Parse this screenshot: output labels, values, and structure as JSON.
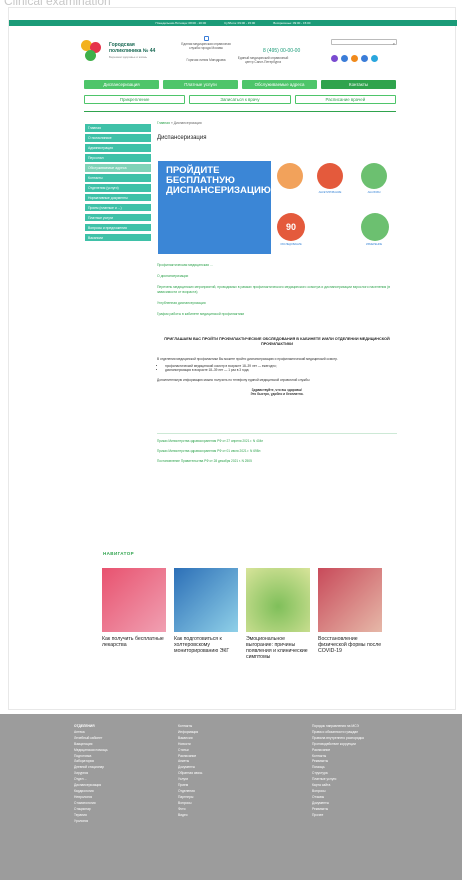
{
  "overlay": {
    "title": "Clinical examination"
  },
  "topbar": {
    "items": [
      "Понедельник-Пятница: 08:00 - 20:00",
      "Суббота: 09:00 - 15:00",
      "Воскресенье: 09:00 - 15:00"
    ]
  },
  "header": {
    "logo_title": "Городская поликлиника № 44",
    "logo_sub": "Бережем здоровье и жизнь",
    "col1": "Единая медицинская справочная служба города Москвы",
    "col2": "Горячая линия Минздрава",
    "col3": "Единый медицинский справочный центр Санкт-Петербурга",
    "phone": "8 (495) 00-00-00",
    "search_placeholder": ""
  },
  "nav": {
    "row1": [
      "Диспансеризация",
      "Платные услуги",
      "Обслуживаемые адреса",
      "Контакты"
    ],
    "row2": [
      "Прикрепление",
      "Записаться к врачу",
      "Расписание врачей"
    ]
  },
  "sidebar": {
    "items": [
      "Главная",
      "О поликлинике",
      "Администрация",
      "Персонал",
      "Обслуживаемые адреса",
      "Контакты",
      "Отделения (услуги)",
      "Нормативные документы",
      "Прием (платные и ...)",
      "Платные услуги",
      "Вопросы и предложения",
      "Вакансии"
    ]
  },
  "content": {
    "breadcrumb_home": "Главная",
    "breadcrumb_sep": " » ",
    "breadcrumb_current": "Диспансеризация",
    "title": "Диспансеризация",
    "banner_text": "ПРОЙДИТЕ БЕСПЛАТНУЮ ДИСПАНСЕРИЗАЦИЮ",
    "badge_90": "90",
    "caps": [
      "АНКЕТИРОВАНИЕ",
      "АНАЛИЗЫ",
      "ОБСЛЕДОВАНИЕ",
      "ИЗМЕРЕНИЕ",
      "ПРИЕМ ВРАЧА"
    ],
    "links": [
      "Профилактическая медицинская ...",
      "О диспансеризации",
      "Перечень медицинских мероприятий, проводимых в рамках профилактического медицинского осмотра и диспансеризации взрослого населения (в зависимости от возраста)",
      "Углубленная диспансеризация",
      "График работы в кабинете медицинской профилактики"
    ],
    "invite": "ПРИГЛАШАЕМ ВАС ПРОЙТИ ПРОФИЛАКТИЧЕСКИЕ ОБСЛЕДОВАНИЯ В КАБИНЕТЕ И/ИЛИ ОТДЕЛЕНИИ МЕДИЦИНСКОЙ ПРОФИЛАКТИКИ",
    "body_intro": "В отделении медицинской профилактики Вы можете пройти диспансеризацию и профилактический медицинский осмотр.",
    "bullet1": "профилактический медицинский осмотр в возрасте 18–39 лет — ежегодно;",
    "bullet2": "диспансеризация в возрасте 18–39 лет — 1 раз в 3 года;",
    "body_more": "Дополнительную информацию можно получить по телефону единой медицинской справочной службы",
    "closing1": "Здравствуйте, что вы здоровы!",
    "closing2": "Это быстро, удобно и бесплатно.",
    "docs": [
      "Приказ Министерства здравоохранения РФ от 27 апреля 2021 г. N 404н",
      "Приказ Министерства здравоохранения РФ от 01 июля 2021 г. N 698н",
      "Постановление Правительства РФ от 28 декабря 2021 г. N 2505"
    ]
  },
  "navigator": {
    "label": "НАВИГАТОР",
    "cards": [
      {
        "title": "Как получить бесплатные лекарства"
      },
      {
        "title": "Как подготовиться к холтеровскому мониторированию ЭКГ"
      },
      {
        "title": "Эмоциональное выгорание: причины появления и клинические симптомы"
      },
      {
        "title": "Восстановление физической формы после COVID-19"
      }
    ]
  },
  "footer": {
    "col1": [
      "ОТДЕЛЕНИЯ",
      "Аптека",
      "Лечебный кабинет",
      "Вакцинация",
      "Медицинская помощь",
      "Подготовка",
      "Лаборатория",
      "Дневной стационар",
      "Хирургия",
      "Отдел ...",
      "Диспансеризация",
      "Кардиология",
      "Неврология",
      "Стоматология",
      "Стационар",
      "Терапия",
      "Урология"
    ],
    "col2": [
      "Контакты",
      "Информация",
      "Вакансии",
      "Новости",
      "Статьи",
      "Расписание",
      "Анкеты",
      "Документы",
      "Обратная связь",
      "Услуги",
      "Прием",
      "Отделения",
      "Партнеры",
      "Вопросы",
      "Фото",
      "Видео"
    ],
    "col3": [
      "Порядок направления на МСЭ",
      "Права и обязанности граждан",
      "Правила внутреннего распорядка",
      "Противодействие коррупции",
      "Расписание",
      "Контакты",
      "Реквизиты",
      "Помощь",
      "Структура",
      "Платные услуги",
      "Карта сайта",
      "Вопросы",
      "Отзывы",
      "Документы",
      "Реквизиты",
      "Прочее"
    ]
  },
  "colors": {
    "accent": "#4ec56a",
    "teal": "#3fc1a8",
    "blue": "#3b86d6",
    "footer": "#9c9c9c"
  }
}
